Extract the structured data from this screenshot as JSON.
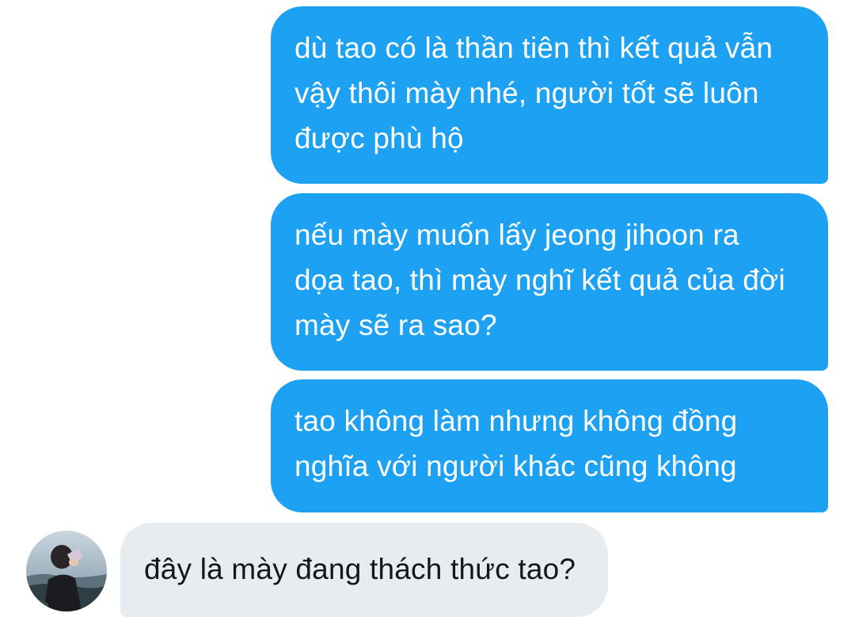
{
  "conversation": {
    "sent_messages": [
      {
        "lines": [
          "dù tao có là thần tiên thì kết quả vẫn",
          "vậy thôi mày nhé, người tốt sẽ luôn",
          "được phù hộ"
        ]
      },
      {
        "lines": [
          "nếu mày muốn lấy jeong jihoon ra",
          "dọa tao, thì mày nghĩ kết quả của đời",
          "mày sẽ ra sao?"
        ]
      },
      {
        "lines": [
          "tao không làm nhưng không đồng",
          "nghĩa với người khác cũng không"
        ]
      }
    ],
    "received_message": {
      "text": "đây là mày đang thách thức tao?",
      "avatar": "user-avatar-photo"
    }
  },
  "colors": {
    "sent_bubble": "#1da1f2",
    "sent_text": "#ffffff",
    "received_bubble": "#e7ecf0",
    "received_text": "#14171a",
    "background": "#ffffff"
  }
}
